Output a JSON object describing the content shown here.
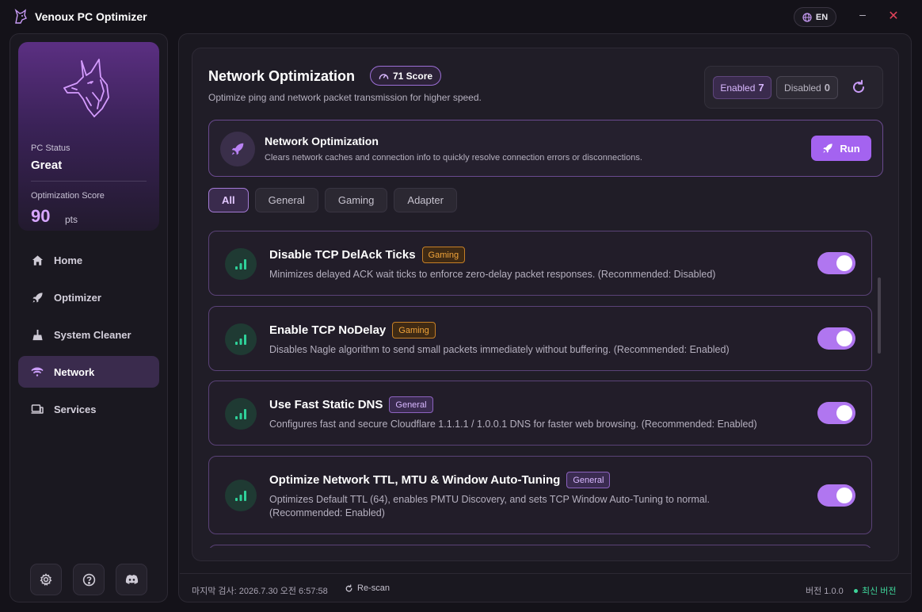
{
  "app": {
    "title": "Venoux PC Optimizer",
    "language": "EN",
    "minimize_glyph": "–",
    "close_glyph": "✕"
  },
  "sidebar": {
    "pc_status_label": "PC Status",
    "pc_status_value": "Great",
    "score_label": "Optimization Score",
    "score_value": "90",
    "score_unit": "pts",
    "items": [
      {
        "label": "Home",
        "icon": "home-icon",
        "active": false
      },
      {
        "label": "Optimizer",
        "icon": "rocket-icon",
        "active": false
      },
      {
        "label": "System Cleaner",
        "icon": "broom-icon",
        "active": false
      },
      {
        "label": "Network",
        "icon": "wifi-icon",
        "active": true
      },
      {
        "label": "Services",
        "icon": "devices-icon",
        "active": false
      }
    ],
    "footer_icons": [
      "settings-icon",
      "help-icon",
      "discord-icon"
    ]
  },
  "header": {
    "title": "Network Optimization",
    "score_badge": "71 Score",
    "subtitle": "Optimize ping and network packet transmission for higher speed.",
    "enabled_label": "Enabled",
    "enabled_count": "7",
    "disabled_label": "Disabled",
    "disabled_count": "0"
  },
  "run_card": {
    "title": "Network Optimization",
    "description": "Clears network caches and connection info to quickly resolve connection errors or disconnections.",
    "button_label": "Run"
  },
  "tabs": [
    {
      "label": "All",
      "active": true
    },
    {
      "label": "General",
      "active": false
    },
    {
      "label": "Gaming",
      "active": false
    },
    {
      "label": "Adapter",
      "active": false
    }
  ],
  "items": [
    {
      "title": "Disable TCP DelAck Ticks",
      "tag": "Gaming",
      "description": "Minimizes delayed ACK wait ticks to enforce zero-delay packet responses. (Recommended: Disabled)",
      "enabled": true
    },
    {
      "title": "Enable TCP NoDelay",
      "tag": "Gaming",
      "description": "Disables Nagle algorithm to send small packets immediately without buffering. (Recommended: Enabled)",
      "enabled": true
    },
    {
      "title": "Use Fast Static DNS",
      "tag": "General",
      "description": "Configures fast and secure Cloudflare 1.1.1.1 / 1.0.0.1 DNS for faster web browsing. (Recommended: Enabled)",
      "enabled": true
    },
    {
      "title": "Optimize Network TTL, MTU & Window Auto-Tuning",
      "tag": "General",
      "description": "Optimizes Default TTL (64), enables PMTU Discovery, and sets TCP Window Auto-Tuning to normal.",
      "description_line2": "(Recommended: Enabled)",
      "enabled": true
    }
  ],
  "statusbar": {
    "last_scan": "마지막 검사: 2026.7.30 오전 6:57:58",
    "rescan_label": "Re-scan",
    "version": "버전 1.0.0",
    "latest": "최신 버전"
  },
  "colors": {
    "accent": "#a463f0",
    "gaming_tag": "#f1a43a",
    "general_tag": "#d8b7ff",
    "status_ok": "#3ed59a"
  }
}
